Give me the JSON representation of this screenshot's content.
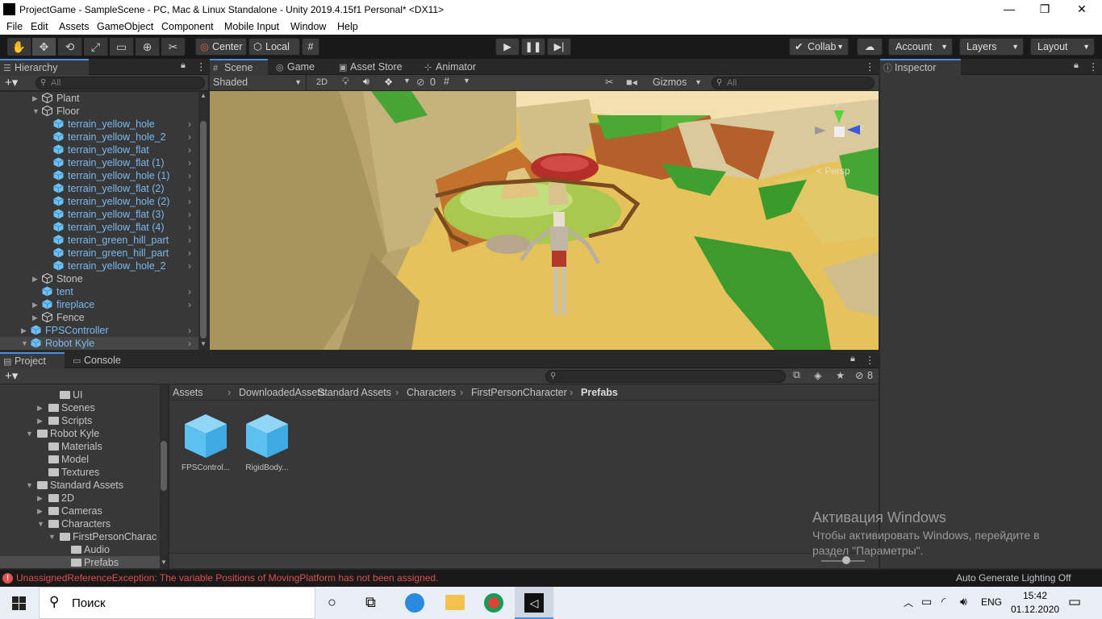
{
  "window": {
    "title": "ProjectGame - SampleScene - PC, Mac & Linux Standalone - Unity 2019.4.15f1 Personal* <DX11>",
    "minimize": "—",
    "maximize": "❐",
    "close": "✕"
  },
  "menu": [
    "File",
    "Edit",
    "Assets",
    "GameObject",
    "Component",
    "Mobile Input",
    "Window",
    "Help"
  ],
  "toolbar": {
    "pivot": "Center",
    "space": "Local",
    "collab": "Collab",
    "account": "Account",
    "layers": "Layers",
    "layout": "Layout"
  },
  "hierarchy": {
    "tab": "Hierarchy",
    "search_placeholder": "All",
    "rows": [
      {
        "label": "Plant",
        "depth": 3,
        "arrow": "▶",
        "prefab": false,
        "chev": false
      },
      {
        "label": "Floor",
        "depth": 3,
        "arrow": "▼",
        "prefab": false,
        "chev": false
      },
      {
        "label": "terrain_yellow_hole",
        "depth": 4,
        "arrow": "",
        "prefab": true,
        "chev": true
      },
      {
        "label": "terrain_yellow_hole_2",
        "depth": 4,
        "arrow": "",
        "prefab": true,
        "chev": true
      },
      {
        "label": "terrain_yellow_flat",
        "depth": 4,
        "arrow": "",
        "prefab": true,
        "chev": true
      },
      {
        "label": "terrain_yellow_flat (1)",
        "depth": 4,
        "arrow": "",
        "prefab": true,
        "chev": true
      },
      {
        "label": "terrain_yellow_hole (1)",
        "depth": 4,
        "arrow": "",
        "prefab": true,
        "chev": true
      },
      {
        "label": "terrain_yellow_flat (2)",
        "depth": 4,
        "arrow": "",
        "prefab": true,
        "chev": true
      },
      {
        "label": "terrain_yellow_hole (2)",
        "depth": 4,
        "arrow": "",
        "prefab": true,
        "chev": true
      },
      {
        "label": "terrain_yellow_flat (3)",
        "depth": 4,
        "arrow": "",
        "prefab": true,
        "chev": true
      },
      {
        "label": "terrain_yellow_flat (4)",
        "depth": 4,
        "arrow": "",
        "prefab": true,
        "chev": true
      },
      {
        "label": "terrain_green_hill_part",
        "depth": 4,
        "arrow": "",
        "prefab": true,
        "chev": true
      },
      {
        "label": "terrain_green_hill_part",
        "depth": 4,
        "arrow": "",
        "prefab": true,
        "chev": true
      },
      {
        "label": "terrain_yellow_hole_2",
        "depth": 4,
        "arrow": "",
        "prefab": true,
        "chev": true
      },
      {
        "label": "Stone",
        "depth": 3,
        "arrow": "▶",
        "prefab": false,
        "chev": false
      },
      {
        "label": "tent",
        "depth": 3,
        "arrow": "",
        "prefab": true,
        "chev": true
      },
      {
        "label": "fireplace",
        "depth": 3,
        "arrow": "▶",
        "prefab": true,
        "chev": true
      },
      {
        "label": "Fence",
        "depth": 3,
        "arrow": "▶",
        "prefab": false,
        "chev": false
      },
      {
        "label": "FPSController",
        "depth": 2,
        "arrow": "▶",
        "prefab": true,
        "chev": true
      },
      {
        "label": "Robot Kyle",
        "depth": 2,
        "arrow": "▼",
        "prefab": true,
        "chev": true
      }
    ]
  },
  "scene_tabs": [
    {
      "label": "Scene",
      "icon": "#",
      "active": true
    },
    {
      "label": "Game",
      "icon": "◎",
      "active": false
    },
    {
      "label": "Asset Store",
      "icon": "▣",
      "active": false
    },
    {
      "label": "Animator",
      "icon": "⊹",
      "active": false
    }
  ],
  "scene_bar": {
    "shading": "Shaded",
    "mode2d": "2D",
    "hidden_count": "0",
    "gizmos": "Gizmos",
    "search_placeholder": "All",
    "persp": "< Persp",
    "axis_y": "y",
    "axis_z": "z"
  },
  "inspector": {
    "tab": "Inspector"
  },
  "project": {
    "tab_project": "Project",
    "tab_console": "Console",
    "hidden_count": "8",
    "tree": [
      {
        "label": "UI",
        "depth": 4,
        "arrow": ""
      },
      {
        "label": "Scenes",
        "depth": 3,
        "arrow": "▶"
      },
      {
        "label": "Scripts",
        "depth": 3,
        "arrow": "▶"
      },
      {
        "label": "Robot Kyle",
        "depth": 2,
        "arrow": "▼"
      },
      {
        "label": "Materials",
        "depth": 3,
        "arrow": ""
      },
      {
        "label": "Model",
        "depth": 3,
        "arrow": ""
      },
      {
        "label": "Textures",
        "depth": 3,
        "arrow": ""
      },
      {
        "label": "Standard Assets",
        "depth": 2,
        "arrow": "▼"
      },
      {
        "label": "2D",
        "depth": 3,
        "arrow": "▶"
      },
      {
        "label": "Cameras",
        "depth": 3,
        "arrow": "▶"
      },
      {
        "label": "Characters",
        "depth": 3,
        "arrow": "▼"
      },
      {
        "label": "FirstPersonCharac",
        "depth": 4,
        "arrow": "▼"
      },
      {
        "label": "Audio",
        "depth": 5,
        "arrow": ""
      },
      {
        "label": "Prefabs",
        "depth": 5,
        "arrow": "",
        "selected": true
      }
    ],
    "breadcrumb": [
      "Assets",
      "DownloadedAssets",
      "Standard Assets",
      "Characters",
      "FirstPersonCharacter",
      "Prefabs"
    ],
    "assets": [
      "FPSControl...",
      "RigidBody..."
    ]
  },
  "status": {
    "error": "UnassignedReferenceException: The variable Positions of MovingPlatform has not been assigned.",
    "lighting": "Auto Generate Lighting Off"
  },
  "activation": {
    "title": "Активация Windows",
    "line1": "Чтобы активировать Windows, перейдите в",
    "line2": "раздел \"Параметры\"."
  },
  "taskbar": {
    "search": "Поиск",
    "lang": "ENG",
    "time": "15:42",
    "date": "01.12.2020"
  },
  "colors": {
    "accent": "#4a90e2",
    "error": "#e05050",
    "prefab": "#7ab9f0"
  }
}
